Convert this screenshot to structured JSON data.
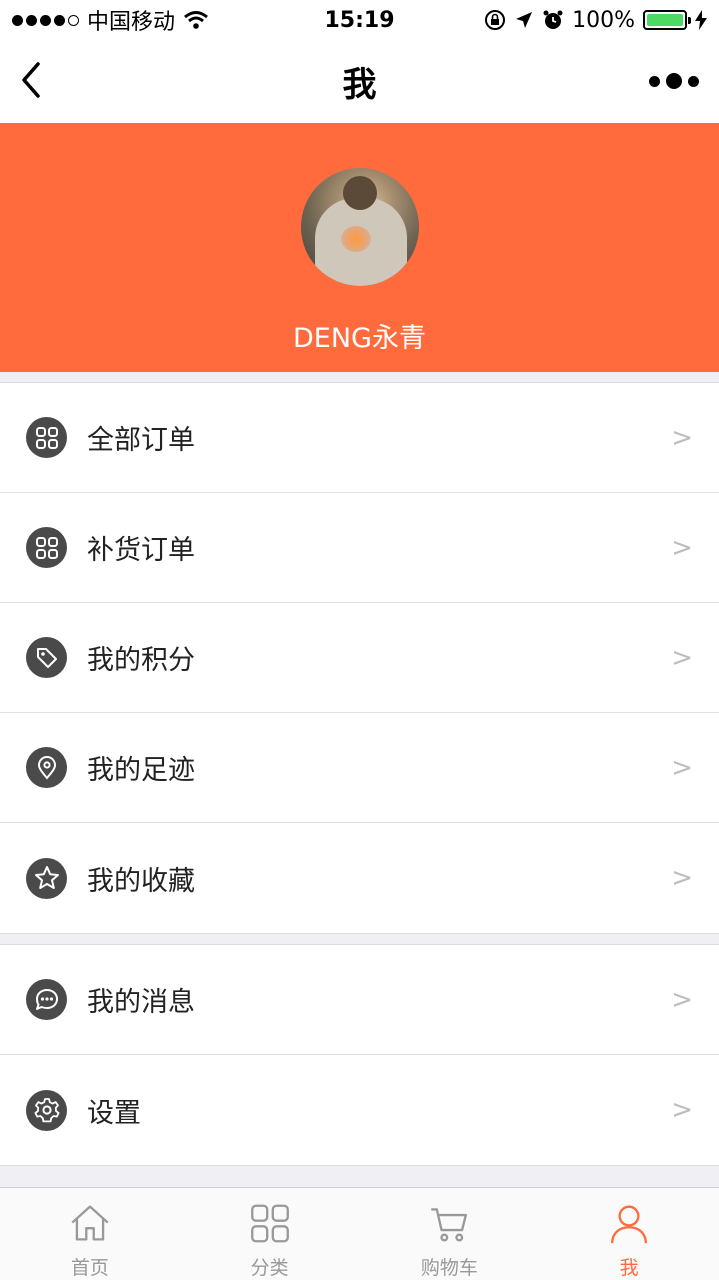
{
  "status_bar": {
    "carrier": "中国移动",
    "time": "15:19",
    "battery": "100%"
  },
  "nav": {
    "title": "我"
  },
  "profile": {
    "username": "DENG永青"
  },
  "menu_group_1": [
    {
      "label": "全部订单",
      "icon": "grid-icon",
      "arrow": ">"
    },
    {
      "label": "补货订单",
      "icon": "grid-icon",
      "arrow": ">"
    },
    {
      "label": "我的积分",
      "icon": "tag-icon",
      "arrow": ">"
    },
    {
      "label": "我的足迹",
      "icon": "location-pin-icon",
      "arrow": ">"
    },
    {
      "label": "我的收藏",
      "icon": "star-icon",
      "arrow": ">"
    }
  ],
  "menu_group_2": [
    {
      "label": "我的消息",
      "icon": "chat-bubble-icon",
      "arrow": ">"
    },
    {
      "label": "设置",
      "icon": "gear-icon",
      "arrow": ">"
    }
  ],
  "tab_bar": [
    {
      "label": "首页",
      "icon": "home-icon",
      "active": false
    },
    {
      "label": "分类",
      "icon": "category-grid-icon",
      "active": false
    },
    {
      "label": "购物车",
      "icon": "cart-icon",
      "active": false
    },
    {
      "label": "我",
      "icon": "person-icon",
      "active": true
    }
  ],
  "colors": {
    "accent": "#ff6b3d",
    "icon_bg": "#4a4a4a",
    "tab_inactive": "#999999"
  }
}
